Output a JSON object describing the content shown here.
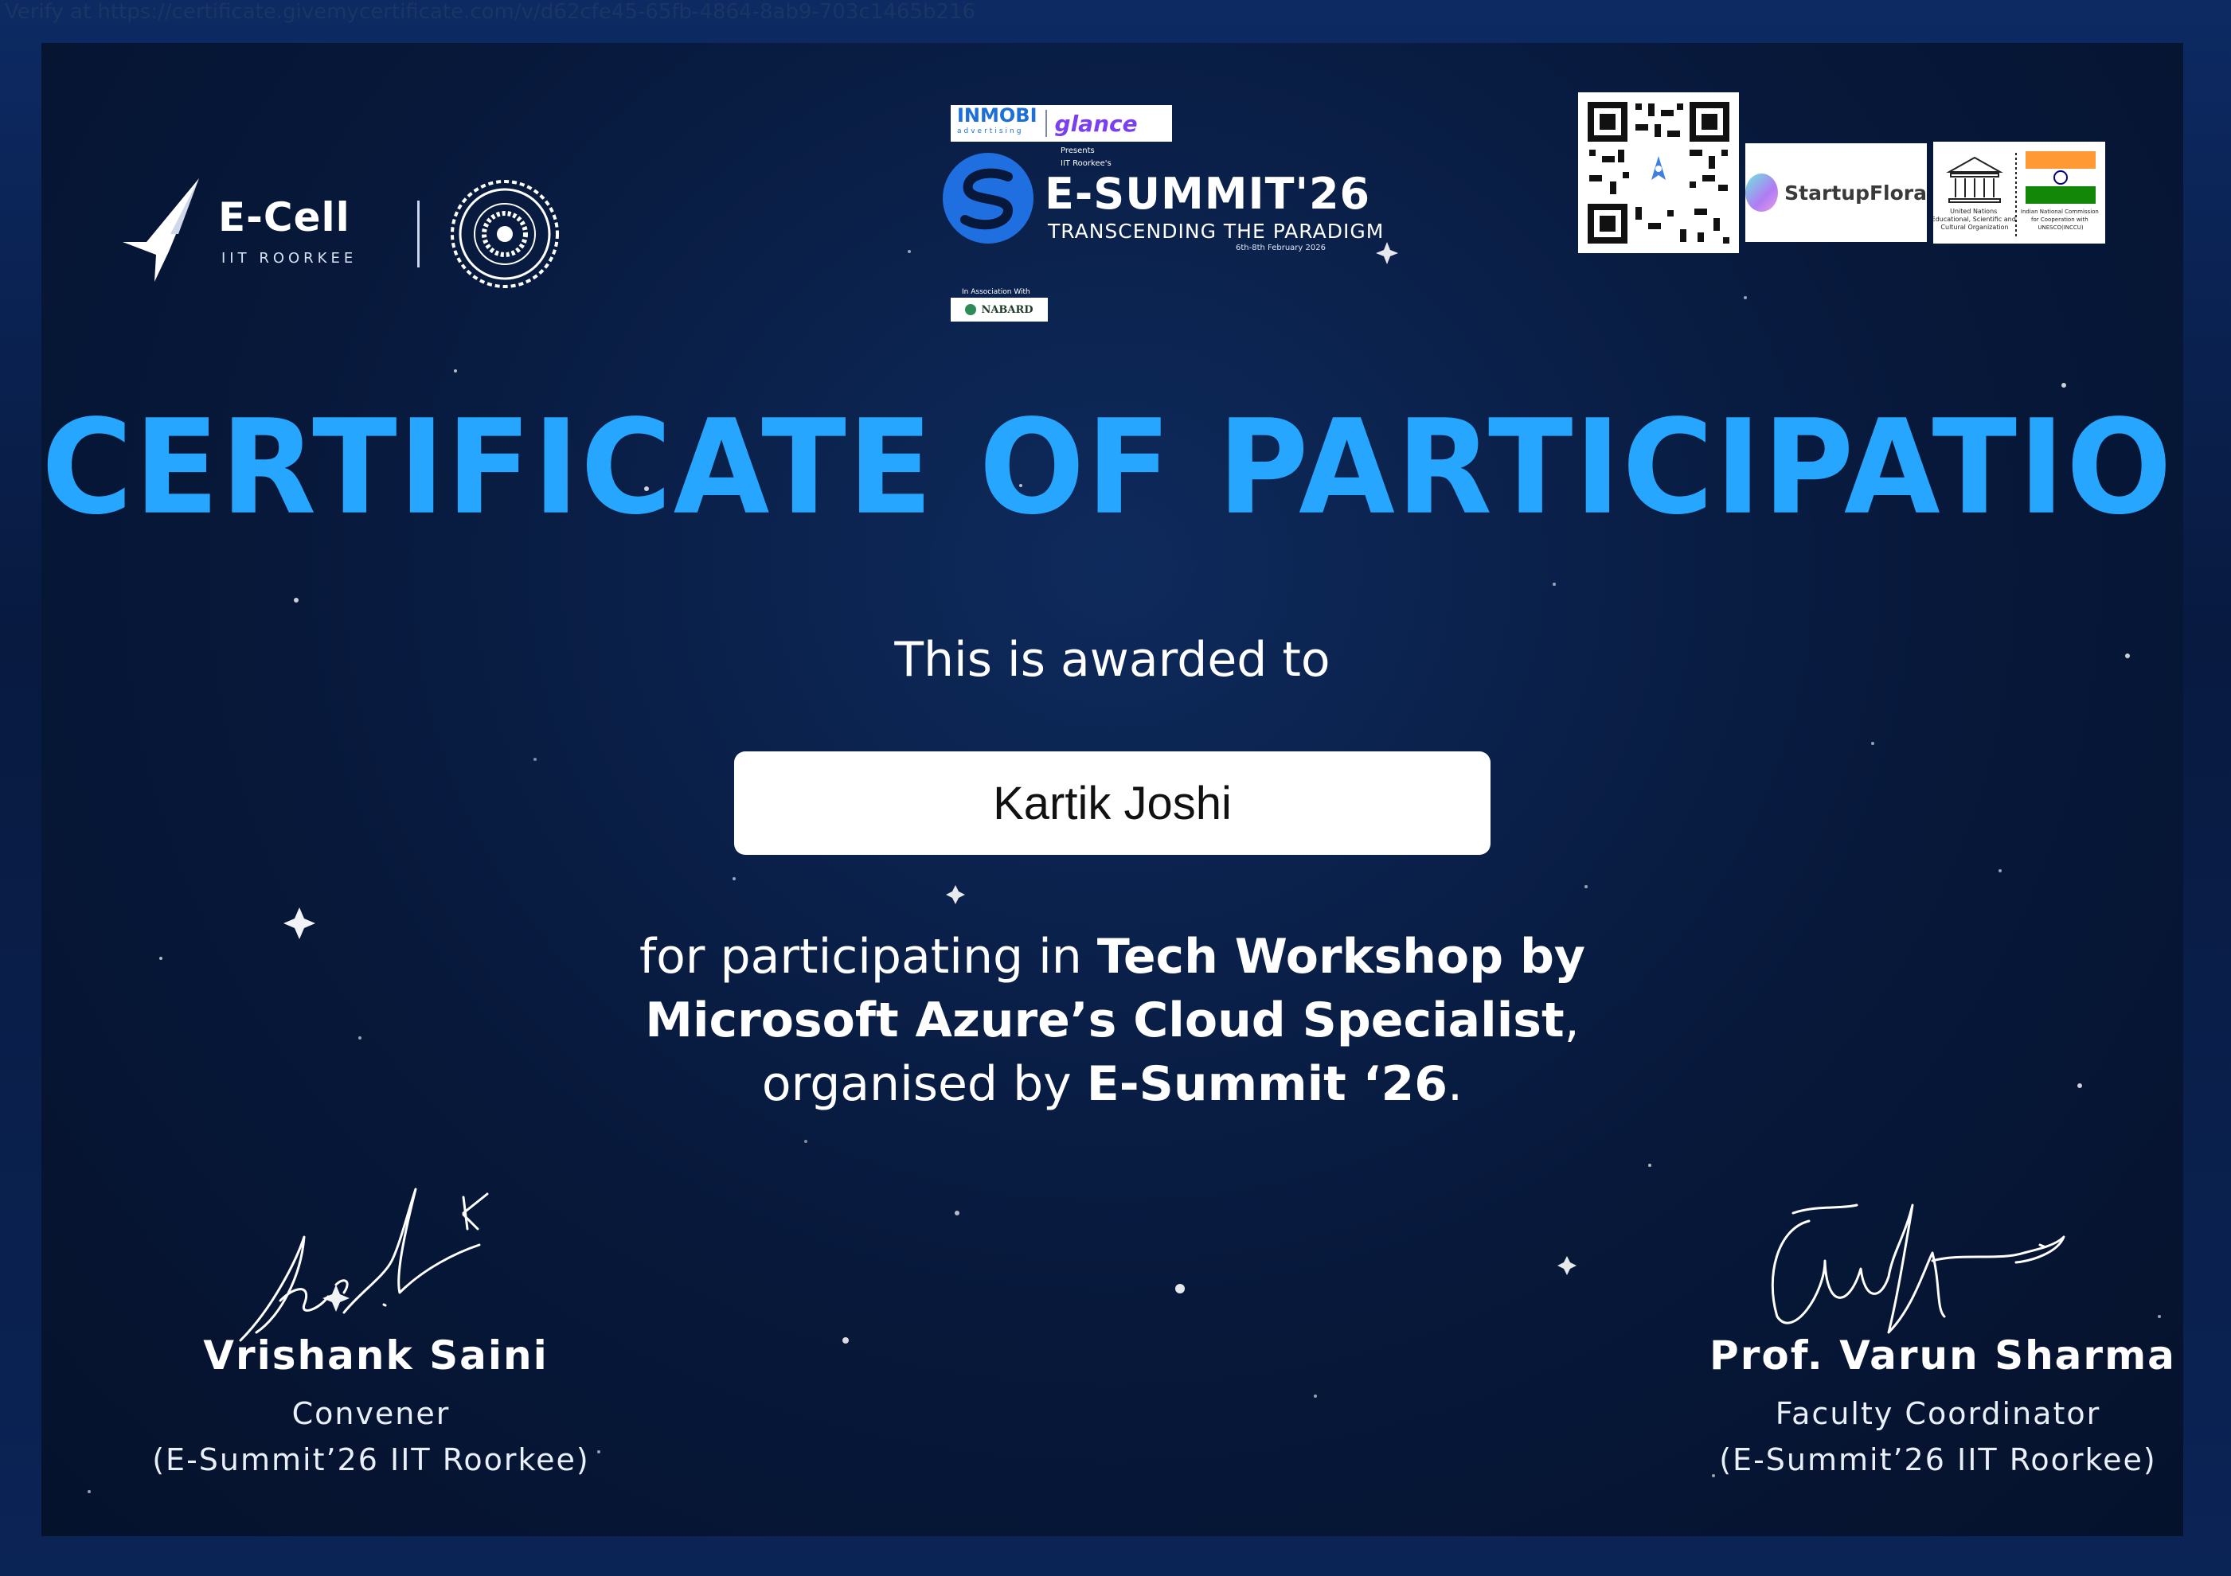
{
  "verify_url": "Verify at https://certificate.givemycertificate.com/v/d62cfe45-65fb-4864-8ab9-703c1465b216",
  "logos": {
    "ecell_title": "E-Cell",
    "ecell_subtitle": "IIT ROORKEE",
    "inmobi": "INMOBI",
    "inmobi_sub": "advertising",
    "glance": "glance",
    "presents": "Presents",
    "iitr_possessive": "IIT Roorkee's",
    "esummit": "E-SUMMIT'26",
    "tagline": "TRANSCENDING THE PARADIGM",
    "dates": "6th-8th February 2026",
    "association": "In Association With",
    "nabard": "NABARD",
    "startupflora": "StartupFlora",
    "unesco_left": "United Nations Educational, Scientific and Cultural Organization",
    "unesco_right": "Indian National Commission for Cooperation with UNESCO(INCCU)"
  },
  "certificate": {
    "title": "CERTIFICATE OF PARTICIPATION",
    "awarded_to": "This is awarded to",
    "recipient_name": "Kartik Joshi",
    "body_prefix": "for participating in ",
    "event_line1": "Tech Workshop by",
    "event_line2": "Microsoft Azure’s Cloud Specialist",
    "body_mid": "organised by ",
    "organiser": "E-Summit ‘26"
  },
  "signatories": [
    {
      "name": "Vrishank Saini",
      "role": "Convener",
      "org": "(E-Summit’26 IIT Roorkee)"
    },
    {
      "name": "Prof. Varun Sharma",
      "role": "Faculty Coordinator",
      "org": "(E-Summit’26 IIT Roorkee)"
    }
  ],
  "colors": {
    "title_blue": "#27a6ff",
    "background_navy": "#07183a"
  }
}
